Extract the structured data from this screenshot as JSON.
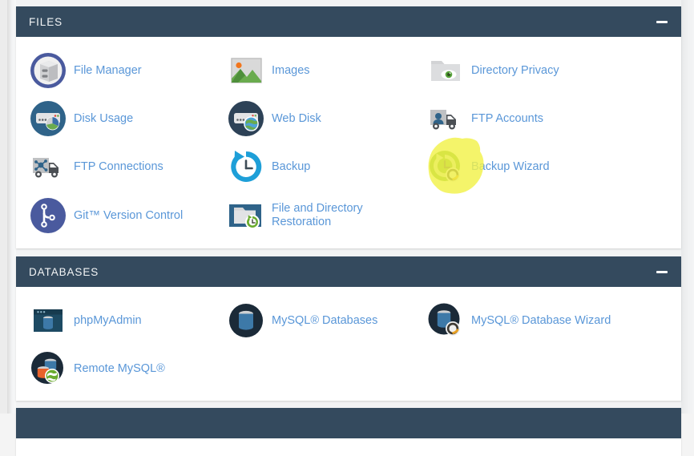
{
  "theme": {
    "header_bg": "#344a5e",
    "link_color": "#5a97d8",
    "card_bg": "#ffffff",
    "page_bg": "#f2f3f4",
    "highlight_color": "#f2f24a"
  },
  "sections": [
    {
      "title": "FILES",
      "collapse_label": "−",
      "rows": [
        [
          {
            "label": "File Manager",
            "icon": "file-manager-icon"
          },
          {
            "label": "Images",
            "icon": "images-icon"
          },
          {
            "label": "Directory Privacy",
            "icon": "directory-privacy-icon"
          }
        ],
        [
          {
            "label": "Disk Usage",
            "icon": "disk-usage-icon"
          },
          {
            "label": "Web Disk",
            "icon": "web-disk-icon"
          },
          {
            "label": "FTP Accounts",
            "icon": "ftp-accounts-icon"
          }
        ],
        [
          {
            "label": "FTP Connections",
            "icon": "ftp-connections-icon"
          },
          {
            "label": "Backup",
            "icon": "backup-icon"
          },
          {
            "label": "Backup Wizard",
            "icon": "backup-wizard-icon",
            "highlighted": true
          }
        ],
        [
          {
            "label": "Git™ Version Control",
            "icon": "git-version-control-icon"
          },
          {
            "label": "File and Directory Restoration",
            "icon": "file-directory-restoration-icon"
          }
        ]
      ]
    },
    {
      "title": "DATABASES",
      "collapse_label": "−",
      "rows": [
        [
          {
            "label": "phpMyAdmin",
            "icon": "phpmyadmin-icon"
          },
          {
            "label": "MySQL® Databases",
            "icon": "mysql-databases-icon"
          },
          {
            "label": "MySQL® Database Wizard",
            "icon": "mysql-database-wizard-icon"
          }
        ],
        [
          {
            "label": "Remote MySQL®",
            "icon": "remote-mysql-icon"
          }
        ]
      ]
    },
    {
      "title": "",
      "collapse_label": "",
      "rows": []
    }
  ],
  "annotation": {
    "type": "highlight-blob",
    "target": "Backup Wizard",
    "color": "#f2f24a"
  }
}
